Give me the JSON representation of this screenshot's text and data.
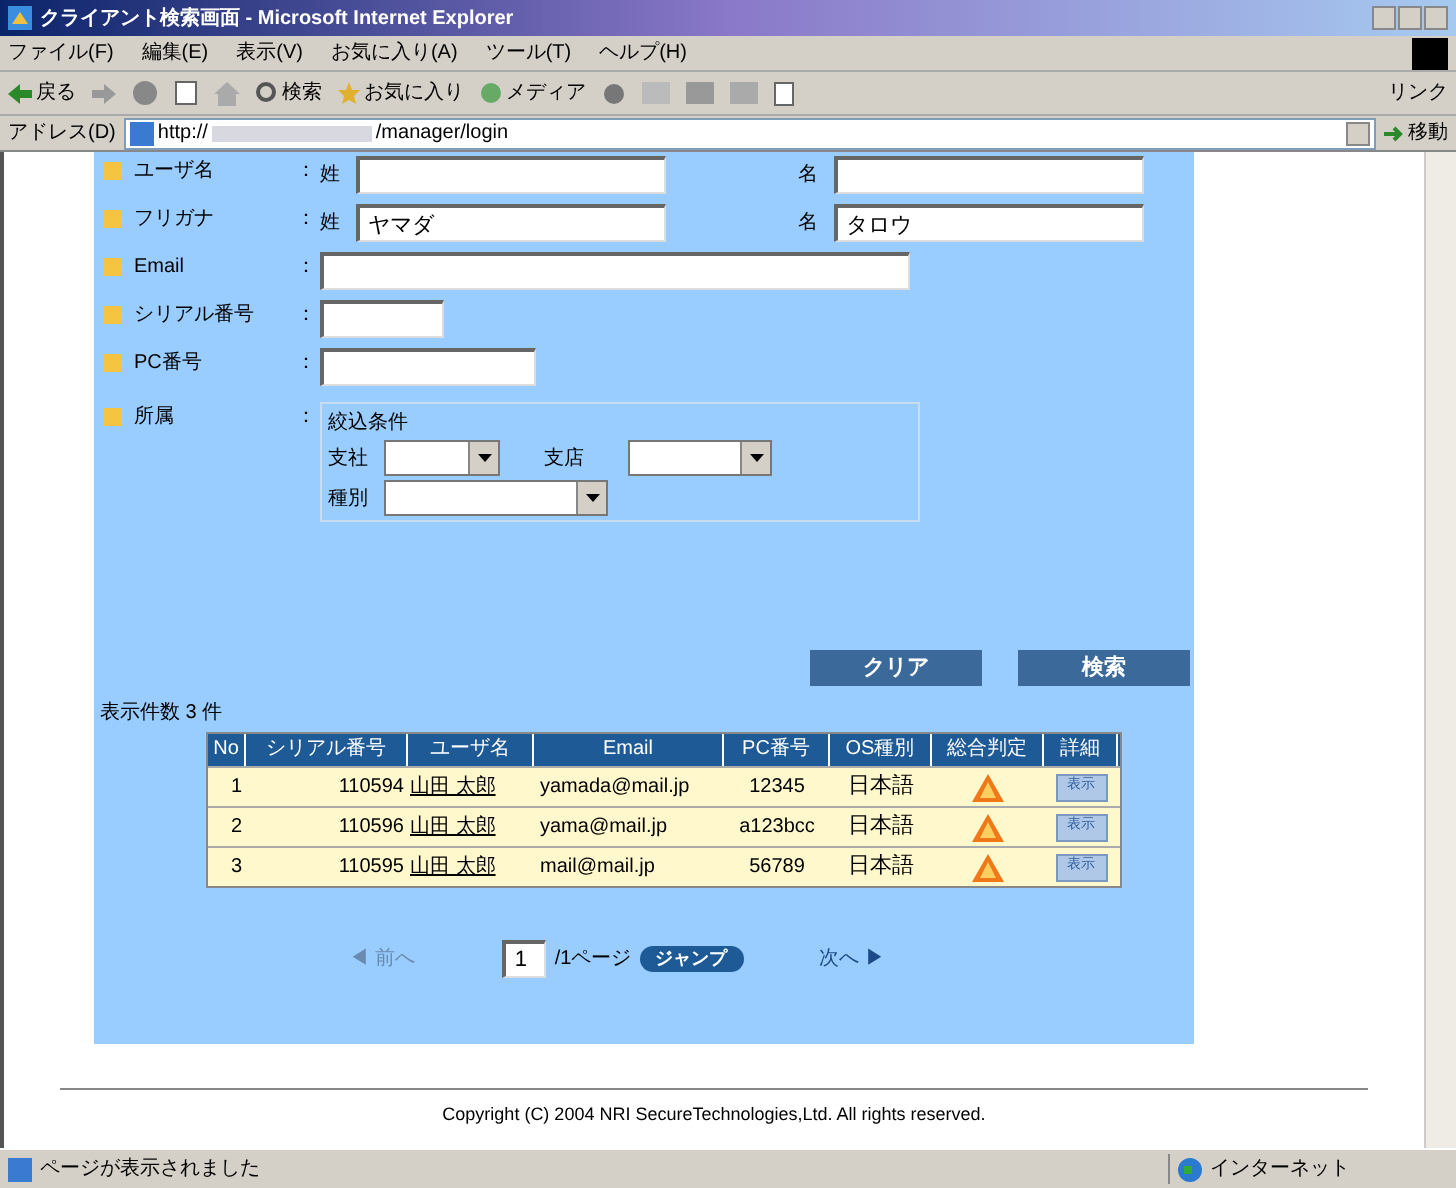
{
  "window": {
    "title": "クライアント検索画面 - Microsoft Internet Explorer"
  },
  "menu": [
    "ファイル(F)",
    "編集(E)",
    "表示(V)",
    "お気に入り(A)",
    "ツール(T)",
    "ヘルプ(H)"
  ],
  "toolbar": [
    "戻る",
    "検索",
    "お気に入り",
    "メディア"
  ],
  "links_label": "リンク",
  "address": {
    "label": "アドレス(D)",
    "scheme": "http://",
    "path": "/manager/login",
    "go": "移動"
  },
  "form": {
    "fields": [
      {
        "kind": "name",
        "label": "ユーザ名",
        "sep": "：",
        "last_label": "姓",
        "first_label": "名"
      },
      {
        "kind": "name",
        "label": "フリガナ",
        "sep": "：",
        "last_label": "姓",
        "last_value": "ヤマダ",
        "first_label": "名",
        "first_value": "タロウ"
      },
      {
        "kind": "wide",
        "label": "Email",
        "sep": "："
      },
      {
        "kind": "short",
        "label": "シリアル番号",
        "sep": "："
      },
      {
        "kind": "medium",
        "label": "PC番号",
        "sep": "："
      },
      {
        "kind": "group",
        "label": "所属",
        "sep": "：",
        "legend": "絞込条件",
        "selects": [
          {
            "label": "支社"
          },
          {
            "label": "支店"
          },
          {
            "label": "種別"
          }
        ]
      }
    ],
    "buttons": [
      "クリア",
      "検索"
    ]
  },
  "result_count": "表示件数 3 件",
  "table": {
    "columns": [
      "No",
      "シリアル番号",
      "ユーザ名",
      "Email",
      "PC番号",
      "OS種別",
      "総合判定",
      "詳細"
    ],
    "rows": [
      {
        "no": "1",
        "serial": "110594",
        "user": "山田 太郎",
        "email": "yamada@mail.jp",
        "pc": "12345",
        "os": "日本語",
        "detail": "表示"
      },
      {
        "no": "2",
        "serial": "110596",
        "user": "山田 太郎",
        "email": "yama@mail.jp",
        "pc": "a123bcc",
        "os": "日本語",
        "detail": "表示"
      },
      {
        "no": "3",
        "serial": "110595",
        "user": "山田 太郎",
        "email": "mail@mail.jp",
        "pc": "56789",
        "os": "日本語",
        "detail": "表示"
      }
    ]
  },
  "pager": {
    "prev": "◀ 前へ",
    "prev_disabled": true,
    "page": "1",
    "suffix": "/1ページ",
    "jump": "ジャンプ",
    "next": "次へ ▶",
    "next_disabled": false
  },
  "footer": "Copyright (C) 2004 NRI SecureTechnologies,Ltd. All rights reserved.",
  "status_bar": {
    "text": "ページが表示されました",
    "zone": "インターネット"
  }
}
